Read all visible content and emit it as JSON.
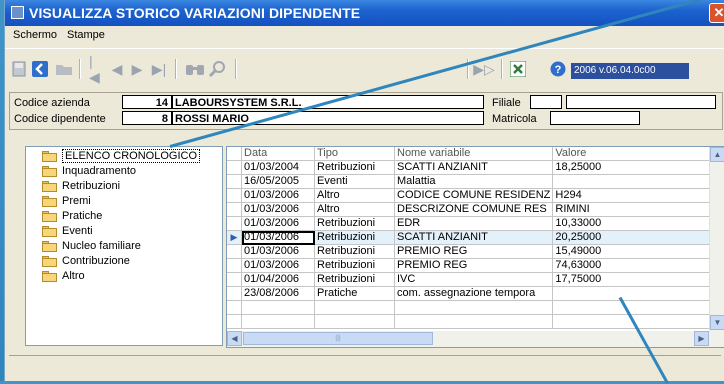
{
  "window": {
    "title": "VISUALIZZA STORICO VARIAZIONI DIPENDENTE"
  },
  "menu": {
    "items": [
      "Schermo",
      "Stampe"
    ]
  },
  "toolbar": {
    "version": "2006 v.06.04.0c00"
  },
  "header": {
    "codice_azienda_label": "Codice azienda",
    "codice_azienda_value": "14",
    "azienda_name": "LABOURSYSTEM S.R.L.",
    "codice_dipendente_label": "Codice dipendente",
    "codice_dipendente_value": "8",
    "dipendente_name": "ROSSI MARIO",
    "filiale_label": "Filiale",
    "filiale_value": "",
    "matricola_label": "Matricola",
    "matricola_value": ""
  },
  "tree": {
    "items": [
      {
        "label": "ELENCO CRONOLOGICO",
        "selected": true
      },
      {
        "label": "Inquadramento",
        "selected": false
      },
      {
        "label": "Retribuzioni",
        "selected": false
      },
      {
        "label": "Premi",
        "selected": false
      },
      {
        "label": "Pratiche",
        "selected": false
      },
      {
        "label": "Eventi",
        "selected": false
      },
      {
        "label": "Nucleo familiare",
        "selected": false
      },
      {
        "label": "Contribuzione",
        "selected": false
      },
      {
        "label": "Altro",
        "selected": false
      }
    ]
  },
  "grid": {
    "columns": [
      "Data",
      "Tipo",
      "Nome variabile",
      "Valore"
    ],
    "current_row": 5,
    "rows": [
      [
        "01/03/2004",
        "Retribuzioni",
        "SCATTI ANZIANIT",
        "18,25000"
      ],
      [
        "16/05/2005",
        "Eventi",
        "Malattia",
        ""
      ],
      [
        "01/03/2006",
        "Altro",
        "CODICE COMUNE RESIDENZ",
        "H294"
      ],
      [
        "01/03/2006",
        "Altro",
        "DESCRIZONE COMUNE RES",
        "RIMINI"
      ],
      [
        "01/03/2006",
        "Retribuzioni",
        "EDR",
        "10,33000"
      ],
      [
        "01/03/2006",
        "Retribuzioni",
        "SCATTI ANZIANIT",
        "20,25000"
      ],
      [
        "01/03/2006",
        "Retribuzioni",
        "PREMIO REG",
        "15,49000"
      ],
      [
        "01/03/2006",
        "Retribuzioni",
        "PREMIO REG",
        "74,63000"
      ],
      [
        "01/04/2006",
        "Retribuzioni",
        "IVC",
        "17,75000"
      ],
      [
        "23/08/2006",
        "Pratiche",
        "com. assegnazione tempora",
        ""
      ],
      [
        "",
        "",
        "",
        ""
      ],
      [
        "",
        "",
        "",
        ""
      ]
    ]
  },
  "colors": {
    "titlebar": "#1d62cf",
    "accent_callout": "#2f86bd",
    "version_bg": "#2c4f9e"
  }
}
